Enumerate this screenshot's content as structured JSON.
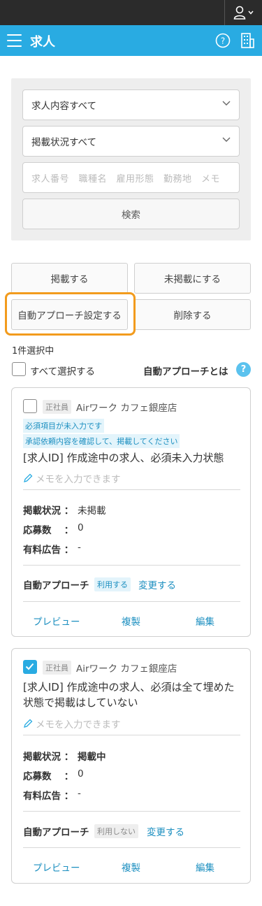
{
  "header": {
    "title": "求人"
  },
  "filters": {
    "content_select": "求人内容すべて",
    "status_select": "掲載状況すべて",
    "search_placeholder": "求人番号　職種名　雇用形態　勤務地　メモ",
    "search_button": "検索"
  },
  "actions": {
    "publish": "掲載する",
    "unpublish": "未掲載にする",
    "auto_approach_settings": "自動アプローチ設定する",
    "delete": "削除する"
  },
  "selection": {
    "count": "1件選択中",
    "select_all": "すべて選択する",
    "auto_approach_what": "自動アプローチとは",
    "help_icon": "?"
  },
  "jobs": [
    {
      "checked": false,
      "employment_type": "正社員",
      "store": "Airワーク カフェ銀座店",
      "notices": [
        "必須項目が未入力です",
        "承認依頼内容を確認して、掲載してください"
      ],
      "title": "[求人ID] 作成途中の求人、必須未入力状態",
      "memo_placeholder": "メモを入力できます",
      "status_label": "掲載状況 ：",
      "status_value": "未掲載",
      "applications_label": "応募数　 ：",
      "applications_value": "0",
      "paid_ad_label": "有料広告 ：",
      "paid_ad_value": "-",
      "auto_approach_label": "自動アプローチ",
      "auto_approach_badge": "利用する",
      "change_link": "変更する",
      "preview": "プレビュー",
      "duplicate": "複製",
      "edit": "編集"
    },
    {
      "checked": true,
      "employment_type": "正社員",
      "store": "Airワーク カフェ銀座店",
      "notices": [],
      "title": "[求人ID] 作成途中の求人、必須は全て埋めた状態で掲載はしていない",
      "memo_placeholder": "メモを入力できます",
      "status_label": "掲載状況 ：",
      "status_value": "掲載中",
      "applications_label": "応募数　 ：",
      "applications_value": "0",
      "paid_ad_label": "有料広告 ：",
      "paid_ad_value": "-",
      "auto_approach_label": "自動アプローチ",
      "auto_approach_badge": "利用しない",
      "change_link": "変更する",
      "preview": "プレビュー",
      "duplicate": "複製",
      "edit": "編集"
    }
  ],
  "colors": {
    "brand": "#29abe2",
    "highlight": "#f29b1d",
    "topbar": "#2b2b2b"
  }
}
